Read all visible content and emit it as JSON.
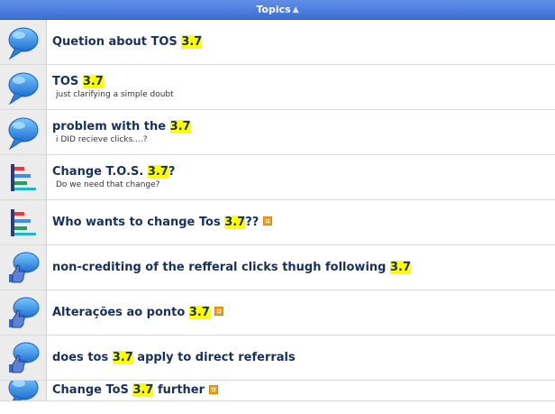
{
  "header": {
    "label": "Topics",
    "sort_icon": "▲"
  },
  "topics": [
    {
      "icon": "speech-bubble-icon",
      "title_before": "Quetion about TOS ",
      "highlight": "3.7",
      "title_after": "",
      "subtitle": ""
    },
    {
      "icon": "speech-bubble-icon",
      "title_before": "TOS ",
      "highlight": "3.7",
      "title_after": "",
      "subtitle": "just clarifying a simple doubt"
    },
    {
      "icon": "speech-bubble-icon",
      "title_before": "problem with the ",
      "highlight": "3.7",
      "title_after": "",
      "subtitle": "i DID recieve clicks....?"
    },
    {
      "icon": "poll-chart-icon",
      "title_before": "Change T.O.S. ",
      "highlight": "3.7",
      "title_after": "?",
      "subtitle": "Do we need that change?"
    },
    {
      "icon": "poll-chart-icon",
      "title_before": "Who wants to change Tos ",
      "highlight": "3.7",
      "title_after": "??",
      "subtitle": ""
    },
    {
      "icon": "speech-bubble-thumbs-up-icon",
      "title_before": "non-crediting of the refferal clicks thugh following ",
      "highlight": "3.7",
      "title_after": "",
      "subtitle": ""
    },
    {
      "icon": "speech-bubble-thumbs-up-icon",
      "title_before": "Alterações ao ponto ",
      "highlight": "3.7",
      "title_after": "",
      "subtitle": ""
    },
    {
      "icon": "speech-bubble-thumbs-up-icon",
      "title_before": "does tos ",
      "highlight": "3.7",
      "title_after": " apply to direct referrals",
      "subtitle": ""
    },
    {
      "icon": "speech-bubble-icon",
      "title_before": "Change ToS ",
      "highlight": "3.7",
      "title_after": " further",
      "subtitle": ""
    }
  ]
}
